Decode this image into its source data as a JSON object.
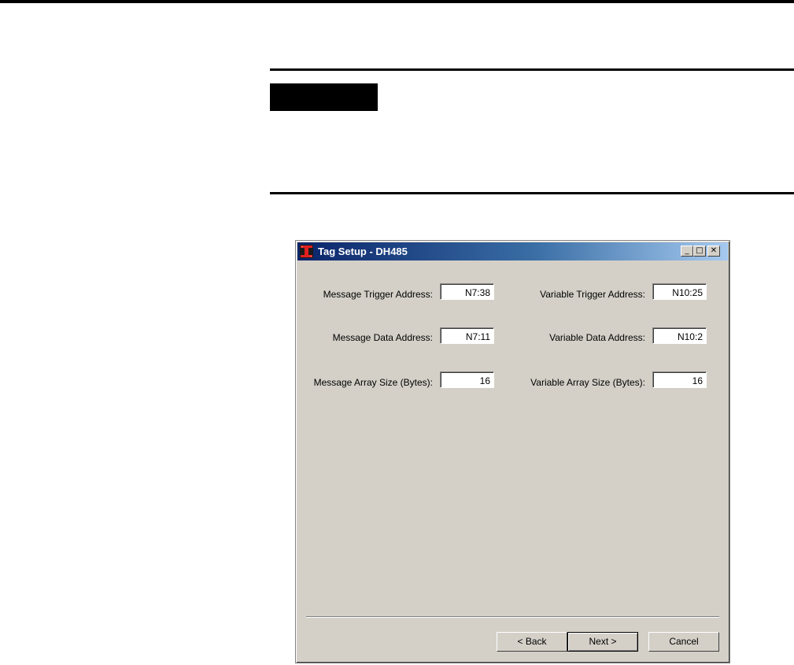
{
  "window": {
    "title": "Tag Setup - DH485",
    "controls": {
      "minimize": "_",
      "maximize": "□",
      "close": "✕"
    }
  },
  "fields": {
    "message_trigger": {
      "label": "Message Trigger Address:",
      "value": "N7:38"
    },
    "message_data": {
      "label": "Message Data Address:",
      "value": "N7:11"
    },
    "message_array_size": {
      "label": "Message Array Size (Bytes):",
      "value": "16"
    },
    "variable_trigger": {
      "label": "Variable Trigger Address:",
      "value": "N10:25"
    },
    "variable_data": {
      "label": "Variable Data Address:",
      "value": "N10:2"
    },
    "variable_array_size": {
      "label": "Variable Array Size (Bytes):",
      "value": "16"
    }
  },
  "buttons": {
    "back": "< Back",
    "next": "Next >",
    "cancel": "Cancel"
  },
  "icons": {
    "app": "red-allen-bradley-icon"
  }
}
